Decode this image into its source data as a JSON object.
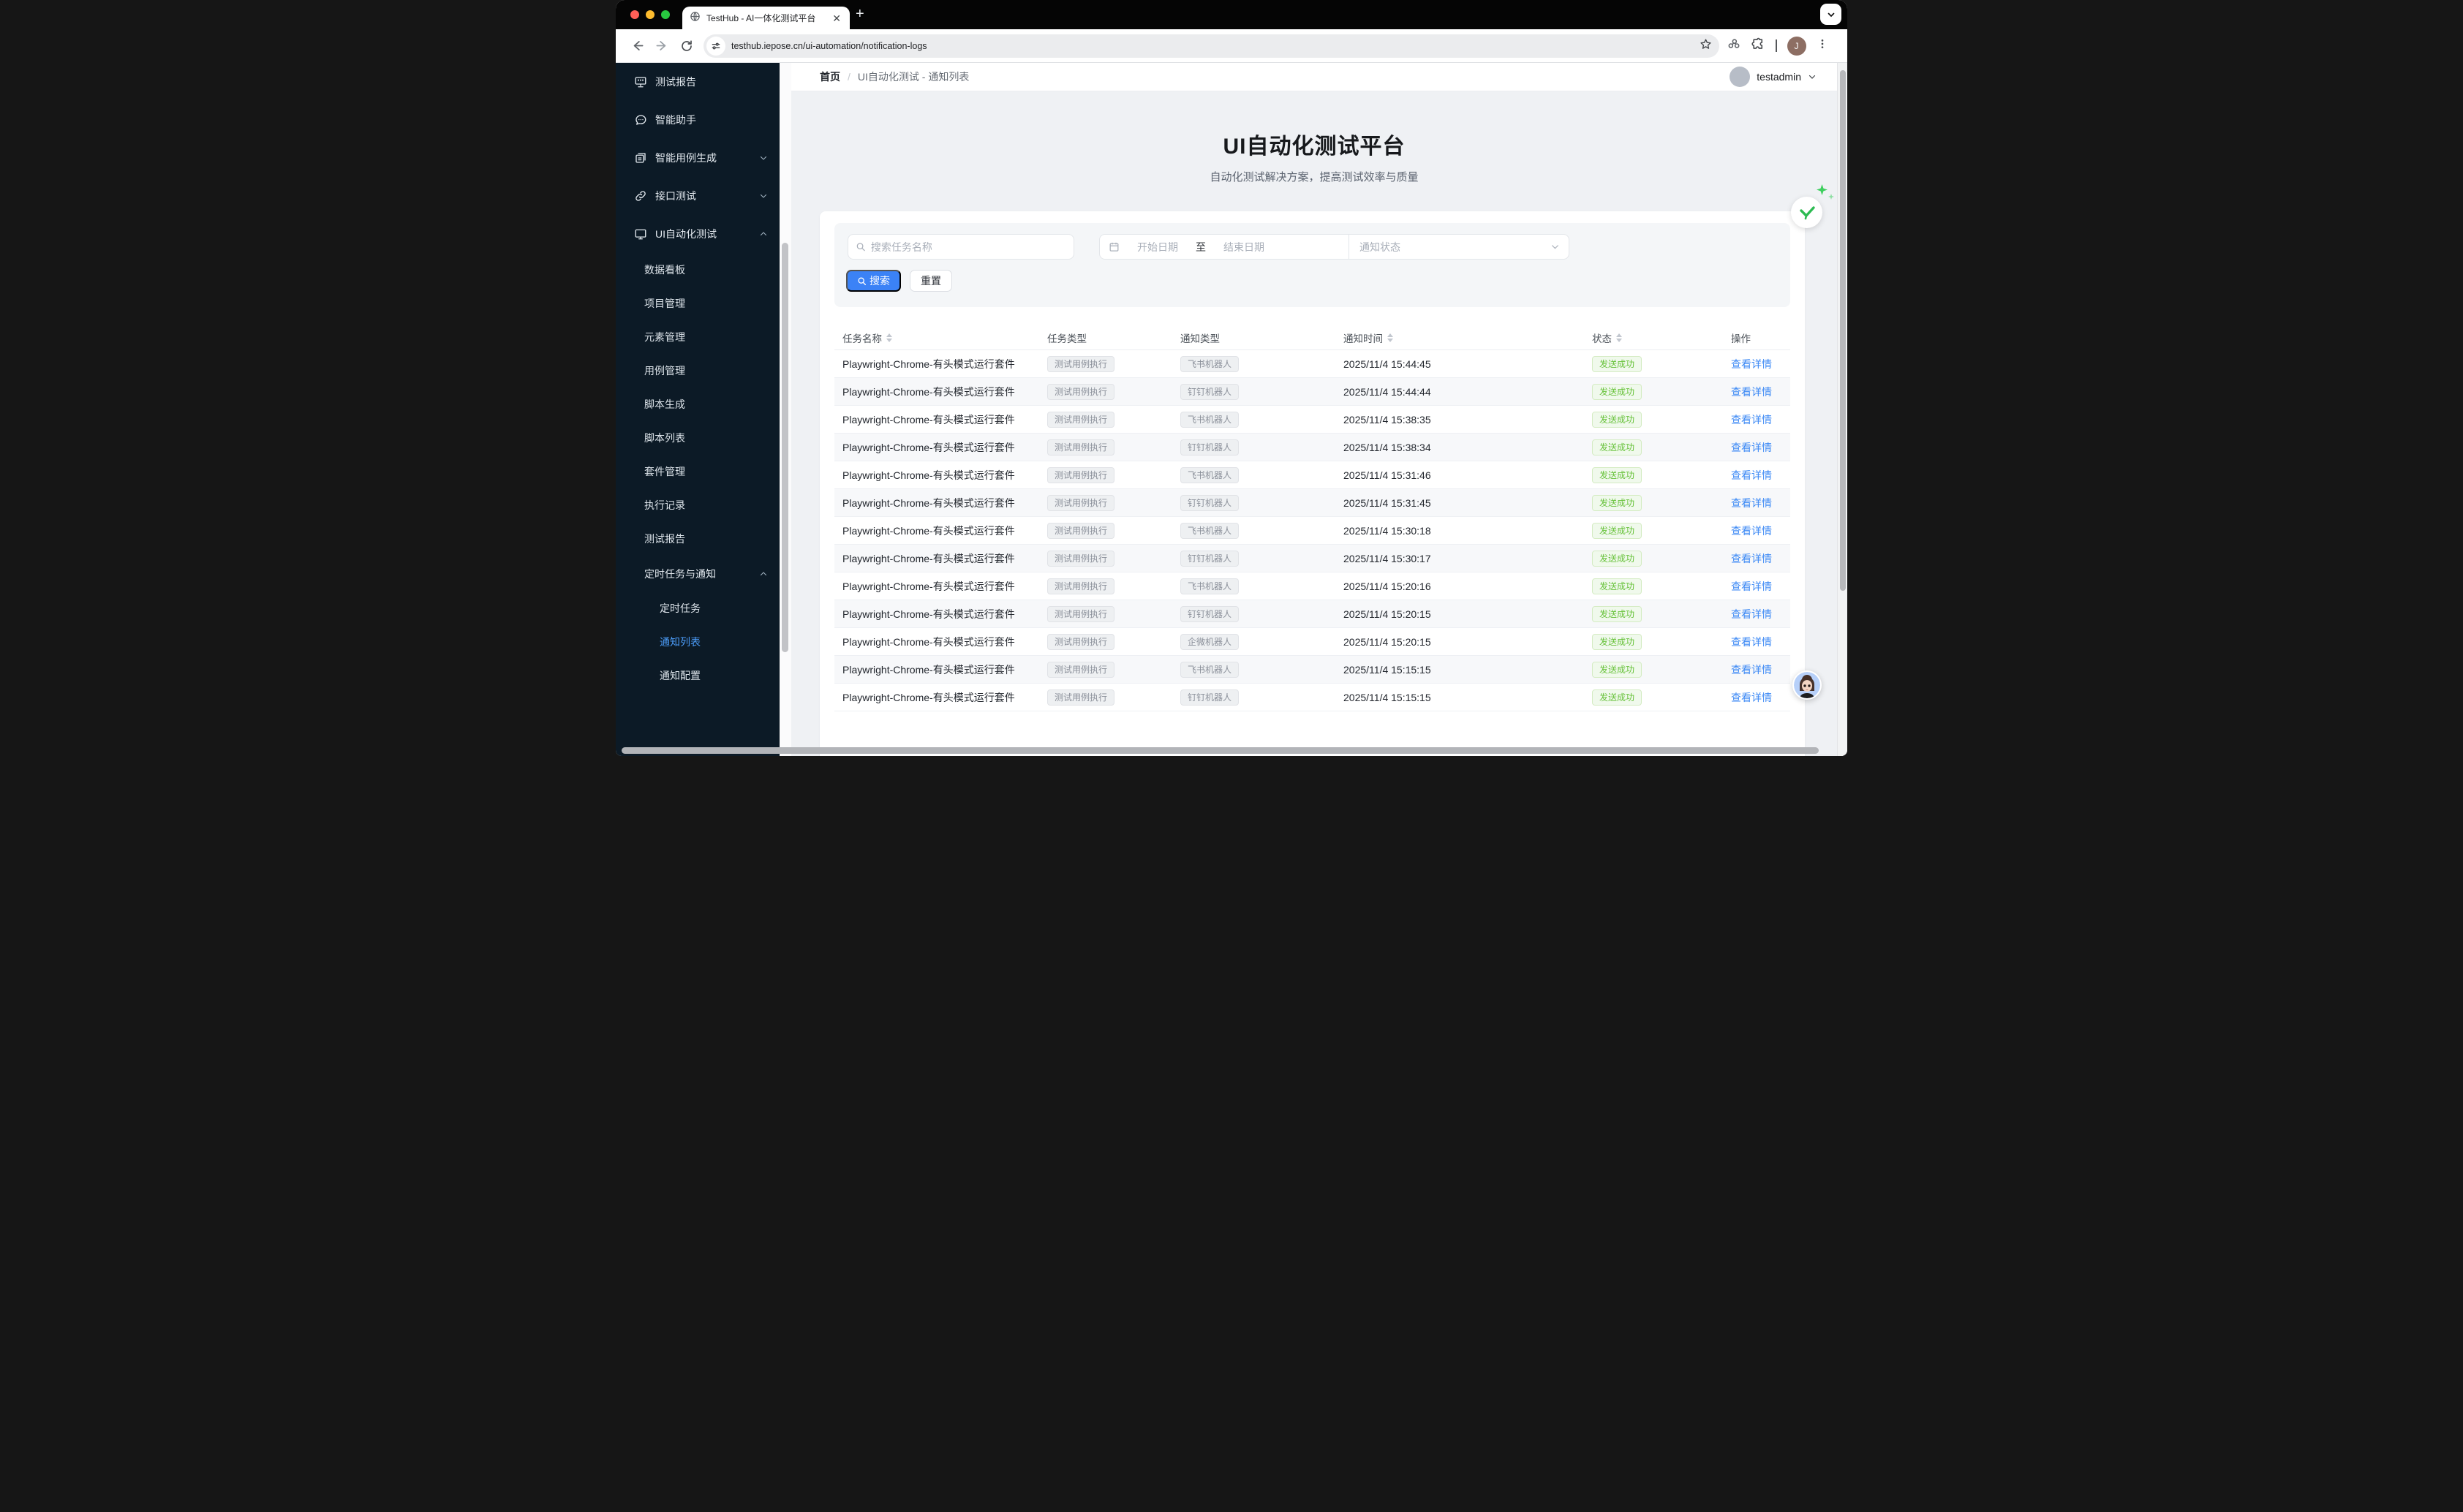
{
  "browser": {
    "tab_title": "TestHub - AI一体化测试平台",
    "url": "testhub.iepose.cn/ui-automation/notification-logs",
    "new_tab_label": "+",
    "close_tab_label": "✕",
    "profile_initial": "J"
  },
  "header": {
    "breadcrumb": {
      "home": "首页",
      "separator": "/",
      "current": "UI自动化测试 - 通知列表"
    },
    "user": {
      "name": "testadmin"
    }
  },
  "sidebar": {
    "items": [
      {
        "label": "测试报告",
        "icon": "report-board-icon",
        "chevron": ""
      },
      {
        "label": "智能助手",
        "icon": "chat-icon",
        "chevron": ""
      },
      {
        "label": "智能用例生成",
        "icon": "cases-icon",
        "chevron": "down"
      },
      {
        "label": "接口测试",
        "icon": "link-icon",
        "chevron": "down"
      },
      {
        "label": "UI自动化测试",
        "icon": "monitor-icon",
        "chevron": "up"
      }
    ],
    "ui_submenu": [
      "数据看板",
      "项目管理",
      "元素管理",
      "用例管理",
      "脚本生成",
      "脚本列表",
      "套件管理",
      "执行记录",
      "测试报告"
    ],
    "group": {
      "label": "定时任务与通知",
      "chevron": "up"
    },
    "group_submenu": [
      {
        "label": "定时任务",
        "active": false
      },
      {
        "label": "通知列表",
        "active": true
      },
      {
        "label": "通知配置",
        "active": false
      }
    ]
  },
  "hero": {
    "title": "UI自动化测试平台",
    "subtitle": "自动化测试解决方案，提高测试效率与质量"
  },
  "filters": {
    "search_placeholder": "搜索任务名称",
    "date_start_placeholder": "开始日期",
    "date_separator": "至",
    "date_end_placeholder": "结束日期",
    "status_placeholder": "通知状态",
    "search_button": "搜索",
    "reset_button": "重置"
  },
  "table": {
    "columns": [
      {
        "label": "任务名称",
        "sortable": true
      },
      {
        "label": "任务类型",
        "sortable": false
      },
      {
        "label": "通知类型",
        "sortable": false
      },
      {
        "label": "通知时间",
        "sortable": true
      },
      {
        "label": "状态",
        "sortable": true
      },
      {
        "label": "操作",
        "sortable": false
      }
    ],
    "rows": [
      {
        "task": "Playwright-Chrome-有头模式运行套件",
        "task_type": "测试用例执行",
        "notify_type": "飞书机器人",
        "time": "2025/11/4 15:44:45",
        "status": "发送成功",
        "action": "查看详情"
      },
      {
        "task": "Playwright-Chrome-有头模式运行套件",
        "task_type": "测试用例执行",
        "notify_type": "钉钉机器人",
        "time": "2025/11/4 15:44:44",
        "status": "发送成功",
        "action": "查看详情"
      },
      {
        "task": "Playwright-Chrome-有头模式运行套件",
        "task_type": "测试用例执行",
        "notify_type": "飞书机器人",
        "time": "2025/11/4 15:38:35",
        "status": "发送成功",
        "action": "查看详情"
      },
      {
        "task": "Playwright-Chrome-有头模式运行套件",
        "task_type": "测试用例执行",
        "notify_type": "钉钉机器人",
        "time": "2025/11/4 15:38:34",
        "status": "发送成功",
        "action": "查看详情"
      },
      {
        "task": "Playwright-Chrome-有头模式运行套件",
        "task_type": "测试用例执行",
        "notify_type": "飞书机器人",
        "time": "2025/11/4 15:31:46",
        "status": "发送成功",
        "action": "查看详情"
      },
      {
        "task": "Playwright-Chrome-有头模式运行套件",
        "task_type": "测试用例执行",
        "notify_type": "钉钉机器人",
        "time": "2025/11/4 15:31:45",
        "status": "发送成功",
        "action": "查看详情"
      },
      {
        "task": "Playwright-Chrome-有头模式运行套件",
        "task_type": "测试用例执行",
        "notify_type": "飞书机器人",
        "time": "2025/11/4 15:30:18",
        "status": "发送成功",
        "action": "查看详情"
      },
      {
        "task": "Playwright-Chrome-有头模式运行套件",
        "task_type": "测试用例执行",
        "notify_type": "钉钉机器人",
        "time": "2025/11/4 15:30:17",
        "status": "发送成功",
        "action": "查看详情"
      },
      {
        "task": "Playwright-Chrome-有头模式运行套件",
        "task_type": "测试用例执行",
        "notify_type": "飞书机器人",
        "time": "2025/11/4 15:20:16",
        "status": "发送成功",
        "action": "查看详情"
      },
      {
        "task": "Playwright-Chrome-有头模式运行套件",
        "task_type": "测试用例执行",
        "notify_type": "钉钉机器人",
        "time": "2025/11/4 15:20:15",
        "status": "发送成功",
        "action": "查看详情"
      },
      {
        "task": "Playwright-Chrome-有头模式运行套件",
        "task_type": "测试用例执行",
        "notify_type": "企微机器人",
        "time": "2025/11/4 15:20:15",
        "status": "发送成功",
        "action": "查看详情"
      },
      {
        "task": "Playwright-Chrome-有头模式运行套件",
        "task_type": "测试用例执行",
        "notify_type": "飞书机器人",
        "time": "2025/11/4 15:15:15",
        "status": "发送成功",
        "action": "查看详情"
      },
      {
        "task": "Playwright-Chrome-有头模式运行套件",
        "task_type": "测试用例执行",
        "notify_type": "钉钉机器人",
        "time": "2025/11/4 15:15:15",
        "status": "发送成功",
        "action": "查看详情"
      }
    ]
  },
  "colors": {
    "accent": "#3b82f6",
    "success": "#67c23a",
    "link": "#3c89f5",
    "sidebar_bg": "#0c1a26",
    "page_bg": "#eff1f4"
  }
}
